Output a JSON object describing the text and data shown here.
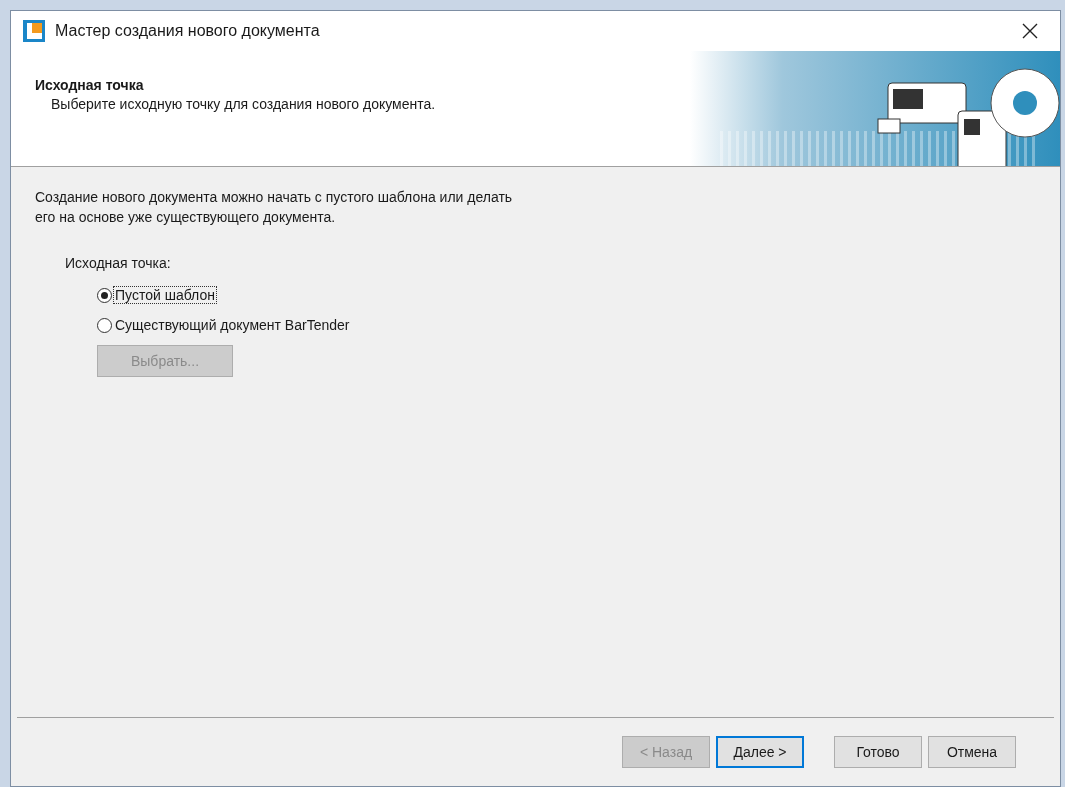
{
  "window": {
    "title": "Мастер создания нового документа"
  },
  "header": {
    "title": "Исходная точка",
    "subtitle": "Выберите исходную точку для создания нового документа."
  },
  "intro": "Создание нового документа можно начать с пустого шаблона или делать его на основе уже существующего документа.",
  "group": {
    "label": "Исходная точка:",
    "options": [
      {
        "label": "Пустой шаблон",
        "selected": true
      },
      {
        "label": "Существующий документ BarTender",
        "selected": false
      }
    ],
    "browse_button": {
      "label": "Выбрать...",
      "disabled": true
    }
  },
  "buttons": [
    {
      "label": "< Назад",
      "disabled": true,
      "default": false
    },
    {
      "label": "Далее >",
      "disabled": false,
      "default": true
    },
    {
      "label": "Готово",
      "disabled": false,
      "default": false
    },
    {
      "label": "Отмена",
      "disabled": false,
      "default": false
    }
  ]
}
